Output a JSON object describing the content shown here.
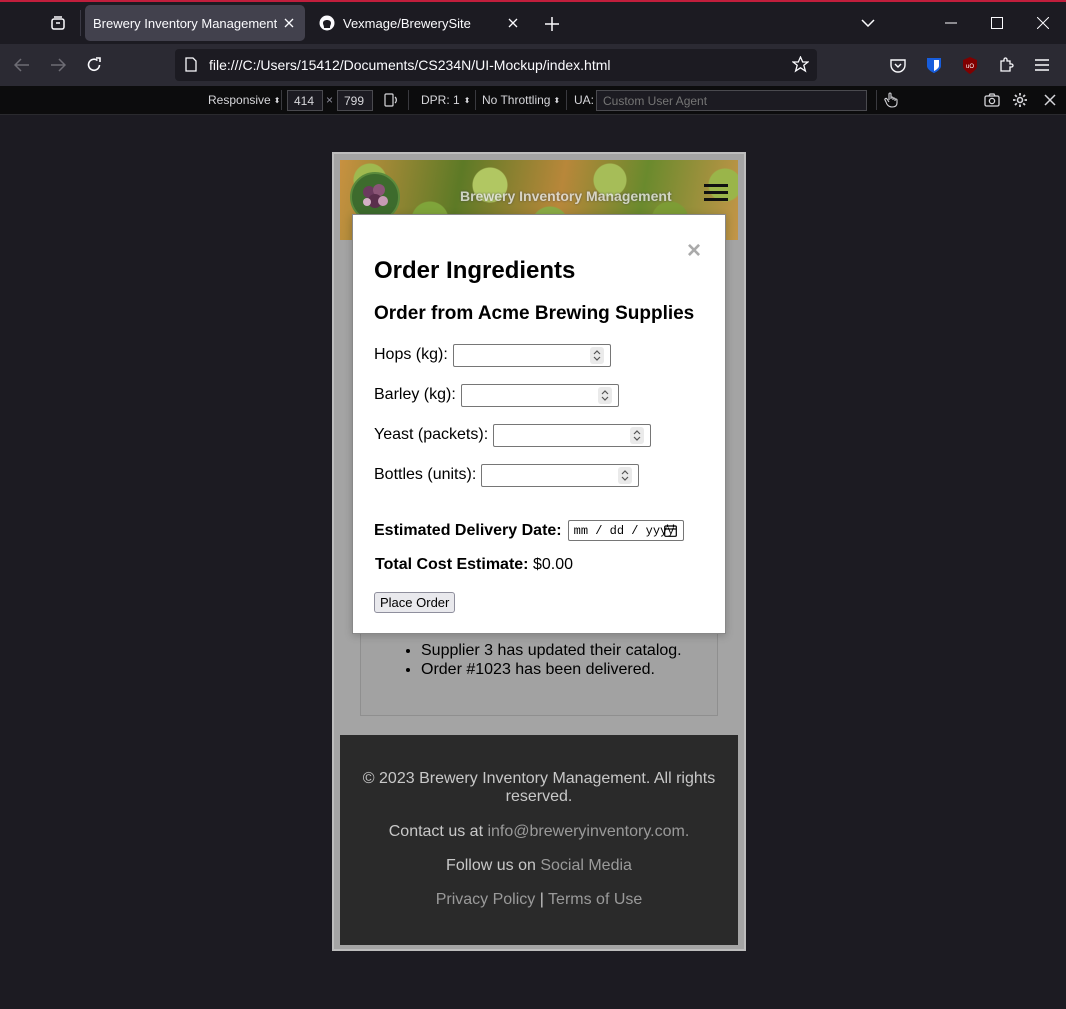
{
  "browser": {
    "tabs": [
      {
        "title": "Brewery Inventory Management",
        "active": true
      },
      {
        "title": "Vexmage/BrewerySite",
        "active": false
      }
    ],
    "url": "file:///C:/Users/15412/Documents/CS234N/UI-Mockup/index.html",
    "accent_color": "#c11e3c"
  },
  "rdm": {
    "device": "Responsive",
    "width": "414",
    "times": "×",
    "height": "799",
    "dpr": "DPR: 1",
    "throttling": "No Throttling",
    "ua_label": "UA:",
    "ua_placeholder": "Custom User Agent"
  },
  "site": {
    "header_title": "Brewery Inventory Management",
    "notifications": [
      "Supplier 3 has updated their catalog.",
      "Order #1023 has been delivered."
    ],
    "footer": {
      "copyright": "© 2023 Brewery Inventory Management. All rights reserved.",
      "contact_prefix": "Contact us at",
      "contact_email": "info@breweryinventory.com.",
      "follow_prefix": "Follow us on",
      "follow_link": "Social Media",
      "privacy": "Privacy Policy",
      "separator": "|",
      "terms": "Terms of Use"
    }
  },
  "modal": {
    "close": "×",
    "title": "Order Ingredients",
    "subtitle": "Order from Acme Brewing Supplies",
    "fields": [
      {
        "label": "Hops (kg):",
        "value": ""
      },
      {
        "label": "Barley (kg):",
        "value": ""
      },
      {
        "label": "Yeast (packets):",
        "value": ""
      },
      {
        "label": "Bottles (units):",
        "value": ""
      }
    ],
    "delivery_label": "Estimated Delivery Date:",
    "delivery_placeholder": "mm / dd / yyyy",
    "total_label": "Total Cost Estimate:",
    "total_value": "$0.00",
    "button": "Place Order"
  }
}
